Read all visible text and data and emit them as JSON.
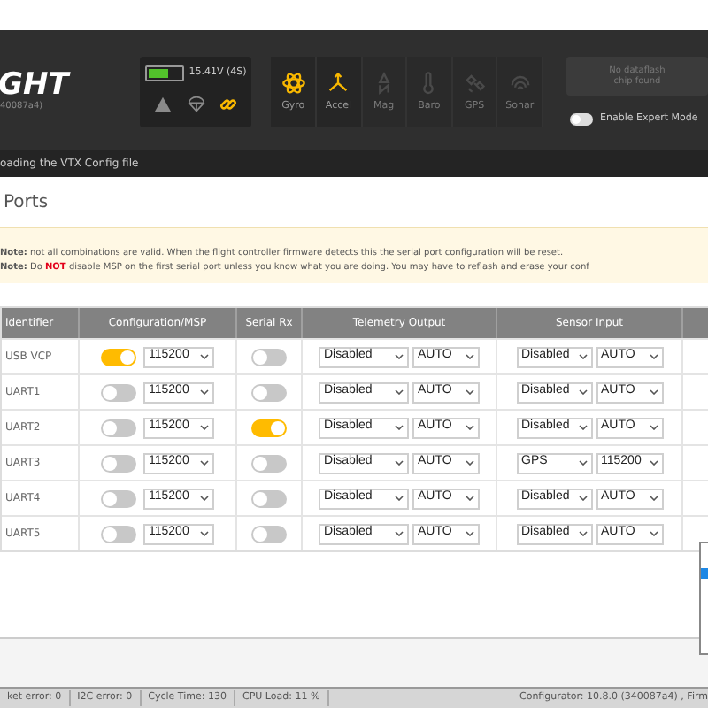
{
  "header": {
    "logo": "GHT",
    "logo_subtext": "40087a4)",
    "battery": {
      "level": 0.6,
      "reading": "15.41V (4S)"
    },
    "status_icons": [
      {
        "kind": "warning",
        "active": false
      },
      {
        "kind": "parachute",
        "active": false
      },
      {
        "kind": "link",
        "active": true
      }
    ],
    "sensors": [
      {
        "kind": "gyro",
        "label": "Gyro",
        "active": true
      },
      {
        "kind": "accel",
        "label": "Accel",
        "active": true
      },
      {
        "kind": "mag",
        "label": "Mag",
        "active": false
      },
      {
        "kind": "baro",
        "label": "Baro",
        "active": false
      },
      {
        "kind": "gps",
        "label": "GPS",
        "active": false
      },
      {
        "kind": "sonar",
        "label": "Sonar",
        "active": false
      }
    ],
    "dataflash": [
      "No dataflash",
      "chip found"
    ],
    "expert_mode": {
      "label": "Enable Expert Mode",
      "on": false
    }
  },
  "log": "oading the VTX Config file",
  "title": "Ports",
  "notes": [
    [
      {
        "kind": "label",
        "text": "Note:"
      },
      {
        "kind": "plain",
        "text": " not all combinations are valid. When the flight controller firmware detects this the serial port configuration will be reset."
      }
    ],
    [
      {
        "kind": "label",
        "text": "Note:"
      },
      {
        "kind": "plain",
        "text": " Do "
      },
      {
        "kind": "alert",
        "text": "NOT"
      },
      {
        "kind": "plain",
        "text": " disable MSP on the first serial port unless you know what you are doing. You may have to reflash and erase your conf"
      }
    ]
  ],
  "table": {
    "columns": [
      "Identifier",
      "Configuration/MSP",
      "Serial Rx",
      "Telemetry Output",
      "Sensor Input"
    ],
    "rows": [
      {
        "identifier": "USB VCP",
        "msp_on": true,
        "msp_baud": "115200",
        "serial_rx": false,
        "telemetry": "Disabled",
        "telemetry_baud": "AUTO",
        "sensor": "Disabled",
        "sensor_baud": "AUTO"
      },
      {
        "identifier": "UART1",
        "msp_on": false,
        "msp_baud": "115200",
        "serial_rx": false,
        "telemetry": "Disabled",
        "telemetry_baud": "AUTO",
        "sensor": "Disabled",
        "sensor_baud": "AUTO"
      },
      {
        "identifier": "UART2",
        "msp_on": false,
        "msp_baud": "115200",
        "serial_rx": true,
        "telemetry": "Disabled",
        "telemetry_baud": "AUTO",
        "sensor": "Disabled",
        "sensor_baud": "AUTO"
      },
      {
        "identifier": "UART3",
        "msp_on": false,
        "msp_baud": "115200",
        "serial_rx": false,
        "telemetry": "Disabled",
        "telemetry_baud": "AUTO",
        "sensor": "GPS",
        "sensor_baud": "115200"
      },
      {
        "identifier": "UART4",
        "msp_on": false,
        "msp_baud": "115200",
        "serial_rx": false,
        "telemetry": "Disabled",
        "telemetry_baud": "AUTO",
        "sensor": "Disabled",
        "sensor_baud": "AUTO"
      },
      {
        "identifier": "UART5",
        "msp_on": false,
        "msp_baud": "115200",
        "serial_rx": false,
        "telemetry": "Disabled",
        "telemetry_baud": "AUTO",
        "sensor": "Disabled",
        "sensor_baud": "AUTO"
      }
    ]
  },
  "status_bar": [
    "ket error: 0",
    "I2C error: 0",
    "Cycle Time: 130",
    "CPU Load: 11 %",
    "Configurator: 10.8.0 (340087a4) , Firm"
  ]
}
